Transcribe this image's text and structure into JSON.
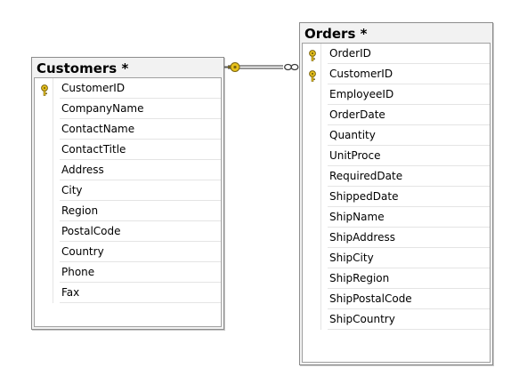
{
  "diagram": {
    "tables": [
      {
        "title": "Customers *",
        "columns": [
          {
            "name": "CustomerID",
            "primary_key": true
          },
          {
            "name": "CompanyName",
            "primary_key": false
          },
          {
            "name": "ContactName",
            "primary_key": false
          },
          {
            "name": "ContactTitle",
            "primary_key": false
          },
          {
            "name": "Address",
            "primary_key": false
          },
          {
            "name": "City",
            "primary_key": false
          },
          {
            "name": "Region",
            "primary_key": false
          },
          {
            "name": "PostalCode",
            "primary_key": false
          },
          {
            "name": "Country",
            "primary_key": false
          },
          {
            "name": "Phone",
            "primary_key": false
          },
          {
            "name": "Fax",
            "primary_key": false
          }
        ]
      },
      {
        "title": "Orders *",
        "columns": [
          {
            "name": "OrderID",
            "primary_key": true
          },
          {
            "name": "CustomerID",
            "primary_key": true
          },
          {
            "name": "EmployeeID",
            "primary_key": false
          },
          {
            "name": "OrderDate",
            "primary_key": false
          },
          {
            "name": "Quantity",
            "primary_key": false
          },
          {
            "name": "UnitProce",
            "primary_key": false
          },
          {
            "name": "RequiredDate",
            "primary_key": false
          },
          {
            "name": "ShippedDate",
            "primary_key": false
          },
          {
            "name": "ShipName",
            "primary_key": false
          },
          {
            "name": "ShipAddress",
            "primary_key": false
          },
          {
            "name": "ShipCity",
            "primary_key": false
          },
          {
            "name": "ShipRegion",
            "primary_key": false
          },
          {
            "name": "ShipPostalCode",
            "primary_key": false
          },
          {
            "name": "ShipCountry",
            "primary_key": false
          }
        ]
      }
    ],
    "relationship": {
      "from_table": "Customers *",
      "to_table": "Orders *",
      "from_end": "one-key-icon",
      "to_end": "many-infinity-icon"
    },
    "colors": {
      "key_icon": "#e8c21c",
      "key_outline": "#7a6410",
      "connector": "#5a5a5a",
      "title_bg": "#f2f2f2"
    }
  }
}
